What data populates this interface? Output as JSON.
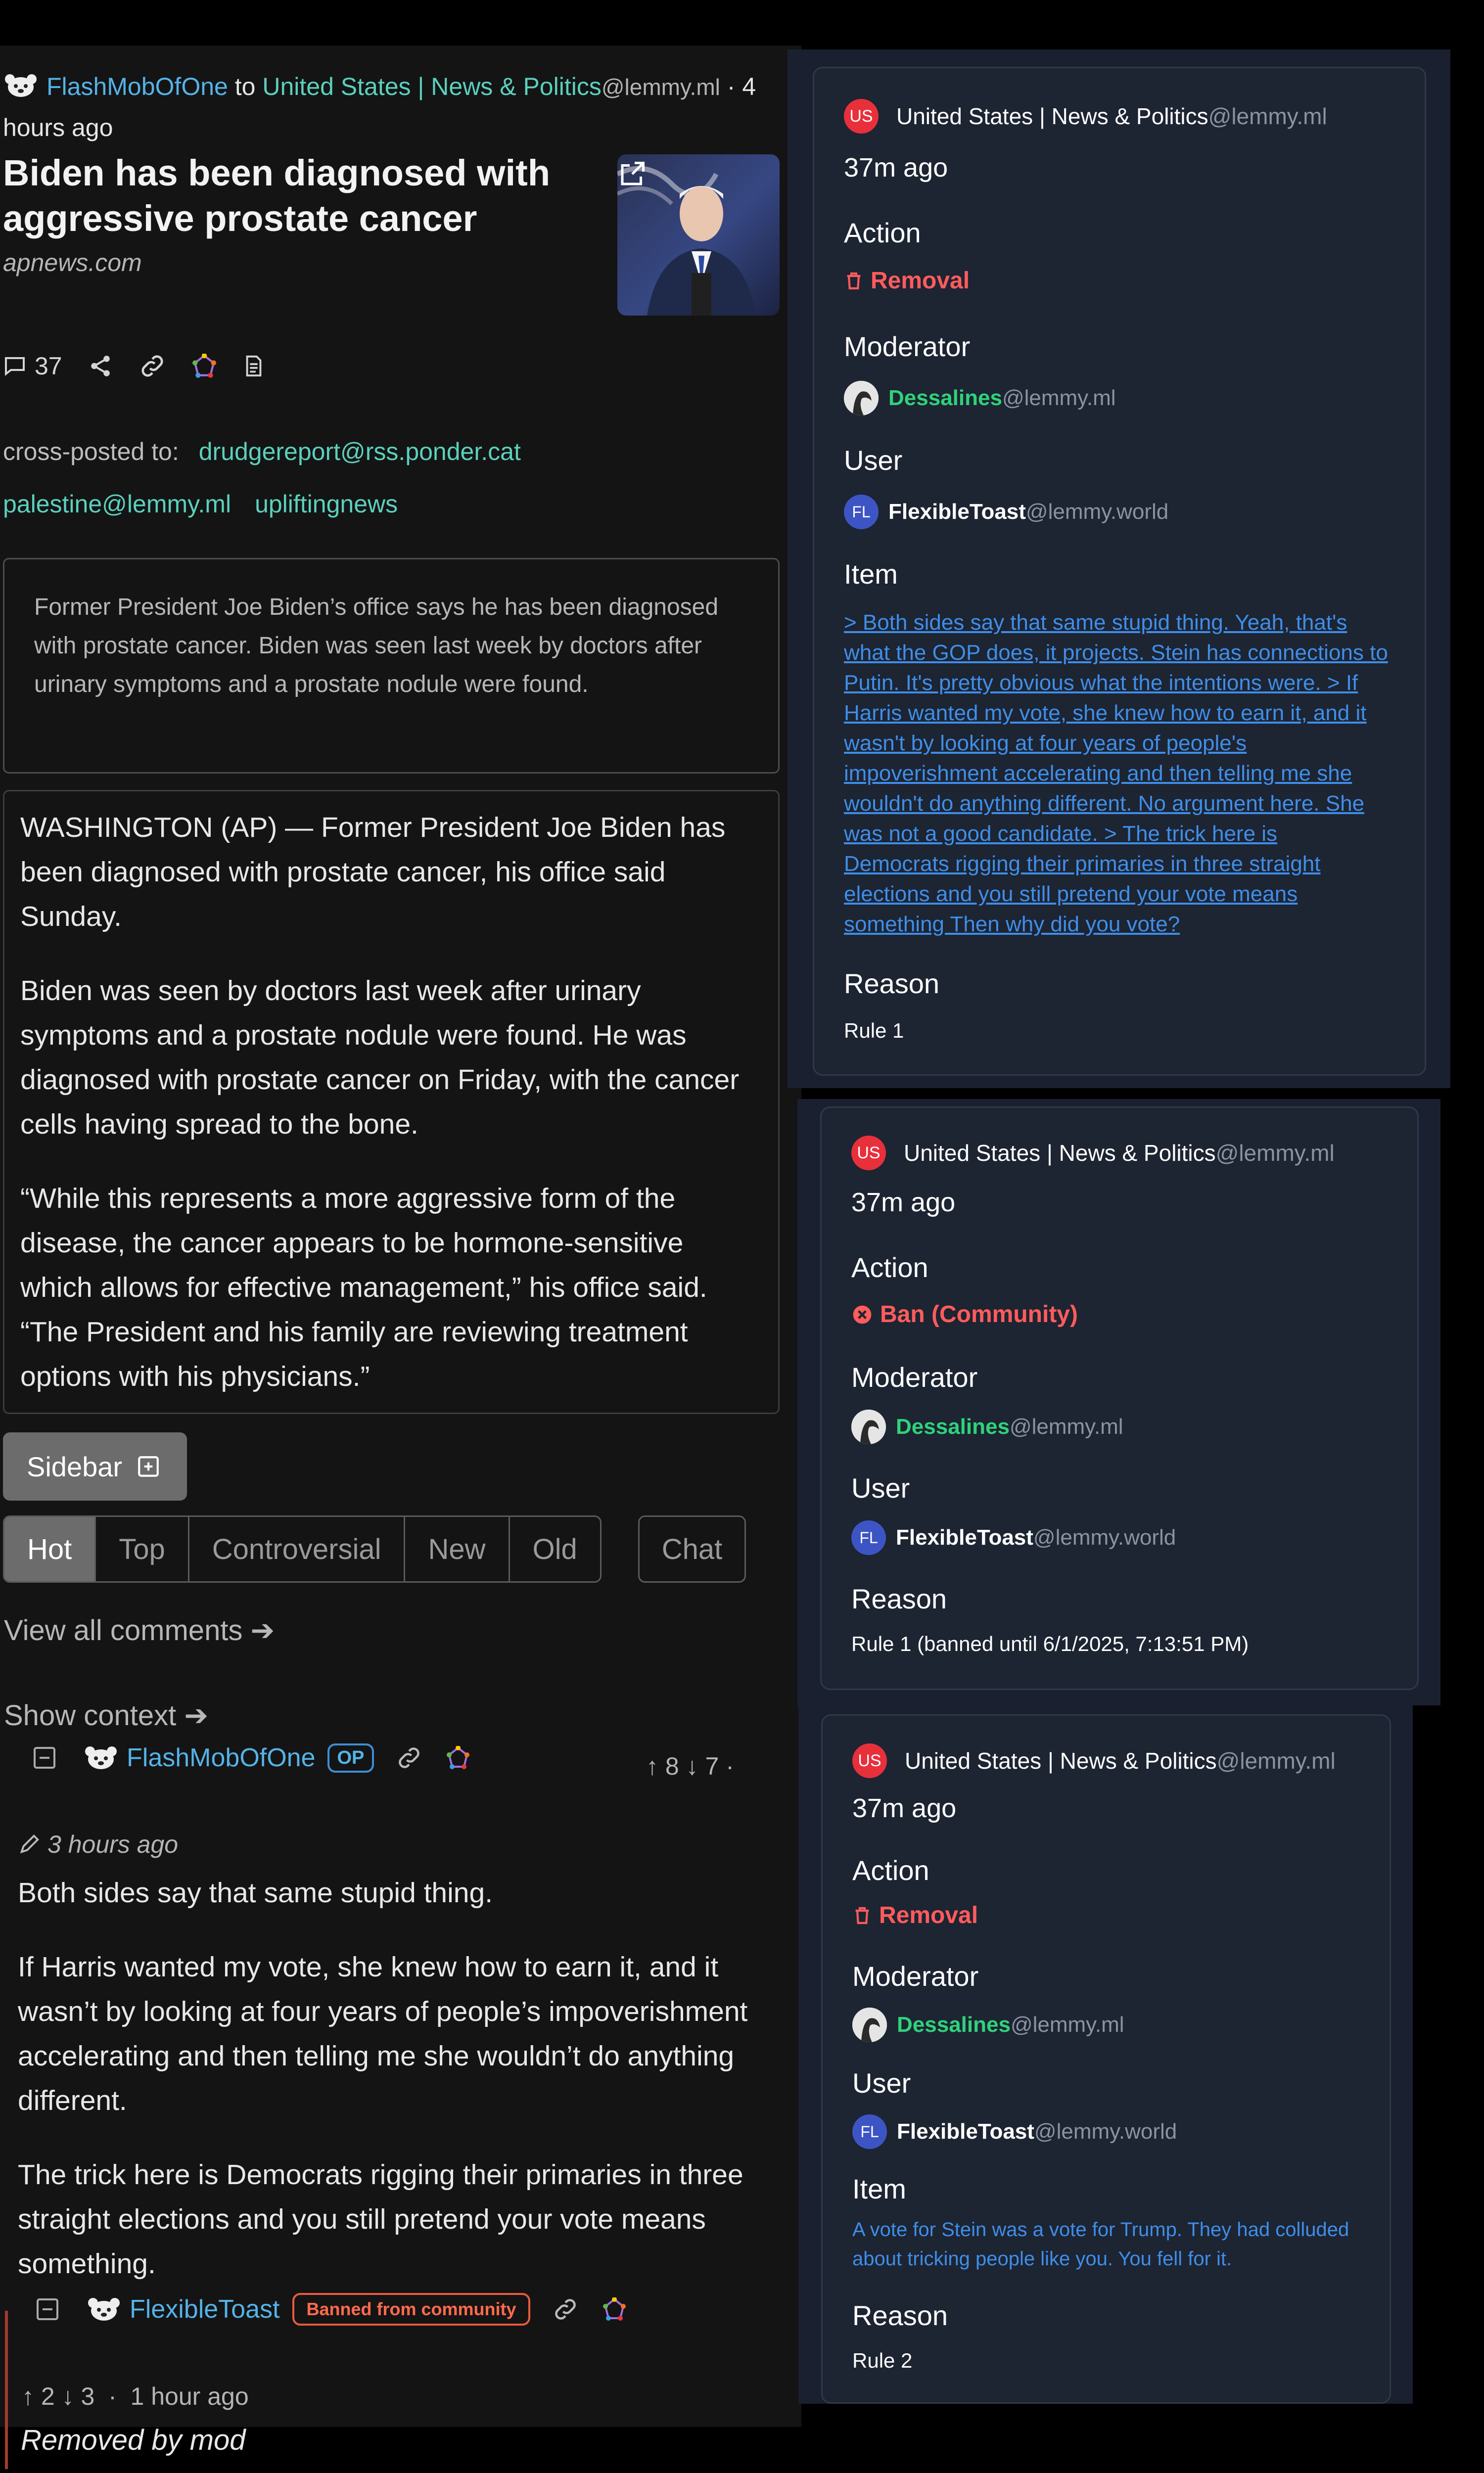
{
  "post": {
    "author": "FlashMobOfOne",
    "to_word": "to",
    "community": "United States | News & Politics",
    "community_instance": "@lemmy.ml",
    "age_line1": "· 4",
    "age_line2": "hours ago",
    "title": "Biden has been diagnosed with aggressive prostate cancer",
    "domain": "apnews.com",
    "comment_count": "37",
    "crosspost_label": "cross-posted to:",
    "crossposts": [
      "drudgereport@rss.ponder.cat",
      "palestine@lemmy.ml",
      "upliftingnews"
    ],
    "summary": "Former President Joe Biden’s office says he has been diagnosed with prostate cancer. Biden was seen last week by doctors after urinary symptoms and a prostate nodule were found.",
    "body": [
      "WASHINGTON (AP) — Former President Joe Biden has been diagnosed with prostate cancer, his office said Sunday.",
      "Biden was seen by doctors last week after urinary symptoms and a prostate nodule were found. He was diagnosed with prostate cancer on Friday, with the cancer cells having spread to the bone.",
      "“While this represents a more aggressive form of the disease, the cancer appears to be hormone-sensitive which allows for effective management,” his office said. “The President and his family are reviewing treatment options with his physicians.”"
    ]
  },
  "controls": {
    "sidebar_label": "Sidebar",
    "sort_options": [
      "Hot",
      "Top",
      "Controversial",
      "New",
      "Old"
    ],
    "active_sort": "Hot",
    "chat_label": "Chat",
    "view_all": "View all comments ➔",
    "show_context": "Show context ➔"
  },
  "comments": [
    {
      "author": "FlashMobOfOne",
      "badge": "OP",
      "upvotes": "8",
      "downvotes": "7",
      "time": "3 hours ago",
      "body": [
        "Both sides say that same stupid thing.",
        "If Harris wanted my vote, she knew how to earn it, and it wasn’t by looking at four years of people’s impoverishment accelerating and then telling me she wouldn’t do anything different.",
        "The trick here is Democrats rigging their primaries in three straight elections and you still pretend your vote means something."
      ]
    },
    {
      "author": "FlexibleToast",
      "badge": "Banned from community",
      "upvotes": "2",
      "downvotes": "3",
      "time": "1 hour ago",
      "body": "Removed by mod"
    }
  ],
  "modlog": [
    {
      "flag": "US",
      "community": "United States | News & Politics",
      "instance": "@lemmy.ml",
      "ago": "37m ago",
      "action_label": "Action",
      "action": "Removal",
      "moderator_label": "Moderator",
      "moderator": "Dessalines",
      "moderator_instance": "@lemmy.ml",
      "user_label": "User",
      "user_initials": "FL",
      "user": "FlexibleToast",
      "user_instance": "@lemmy.world",
      "item_label": "Item",
      "item": "> Both sides say that same stupid thing. Yeah, that's what the GOP does, it projects. Stein has connections to Putin. It's pretty obvious what the intentions were. > If Harris wanted my vote, she knew how to earn it, and it wasn't by looking at four years of people's impoverishment accelerating and then telling me she wouldn't do anything different. No argument here. She was not a good candidate. > The trick here is Democrats rigging their primaries in three straight elections and you still pretend your vote means something Then why did you vote?",
      "reason_label": "Reason",
      "reason": "Rule 1"
    },
    {
      "flag": "US",
      "community": "United States | News & Politics",
      "instance": "@lemmy.ml",
      "ago": "37m ago",
      "action_label": "Action",
      "action": "Ban (Community)",
      "moderator_label": "Moderator",
      "moderator": "Dessalines",
      "moderator_instance": "@lemmy.ml",
      "user_label": "User",
      "user_initials": "FL",
      "user": "FlexibleToast",
      "user_instance": "@lemmy.world",
      "reason_label": "Reason",
      "reason": "Rule 1 (banned until 6/1/2025, 7:13:51 PM)"
    },
    {
      "flag": "US",
      "community": "United States | News & Politics",
      "instance": "@lemmy.ml",
      "ago": "37m ago",
      "action_label": "Action",
      "action": "Removal",
      "moderator_label": "Moderator",
      "moderator": "Dessalines",
      "moderator_instance": "@lemmy.ml",
      "user_label": "User",
      "user_initials": "FL",
      "user": "FlexibleToast",
      "user_instance": "@lemmy.world",
      "item_label": "Item",
      "item": "A vote for Stein was a vote for Trump. They had colluded about tricking people like you. You fell for it.",
      "reason_label": "Reason",
      "reason": "Rule 2"
    }
  ],
  "colors": {
    "page_bg": "#141414",
    "card_bg": "#1d2432",
    "link_blue": "#54b3e8",
    "community_teal": "#5cd0bd",
    "mod_green": "#2fd27a",
    "action_red": "#ff5c5c",
    "item_link": "#3f8ee8"
  },
  "icons": [
    "bear-avatar-icon",
    "comment-icon",
    "share-icon",
    "link-icon",
    "fediverse-icon",
    "text-icon",
    "external-link-icon",
    "plus-square-icon",
    "collapse-icon",
    "pencil-icon",
    "trash-icon",
    "ban-icon"
  ]
}
